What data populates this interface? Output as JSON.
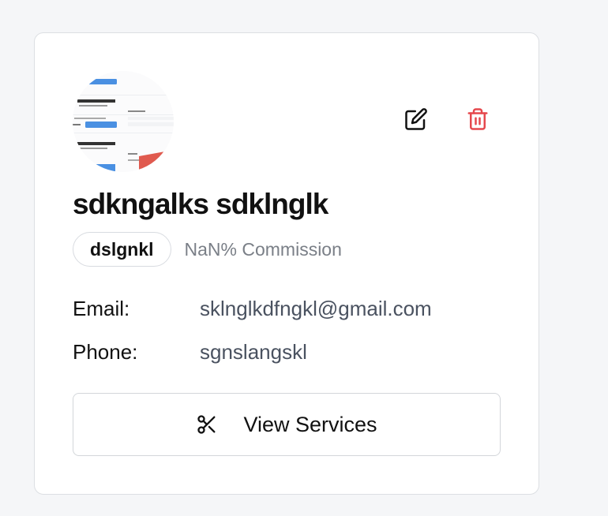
{
  "provider": {
    "name": "sdkngalks sdklnglk",
    "role_badge": "dslgnkl",
    "commission": "NaN% Commission",
    "email_label": "Email:",
    "email_value": "sklnglkdfngkl@gmail.com",
    "phone_label": "Phone:",
    "phone_value": "sgnslangskl",
    "view_services_label": "View Services"
  },
  "icons": {
    "edit": "edit-icon",
    "delete": "trash-icon",
    "services": "scissors-icon"
  },
  "colors": {
    "delete": "#e5484d",
    "text": "#111111",
    "muted": "#7a7f87"
  }
}
